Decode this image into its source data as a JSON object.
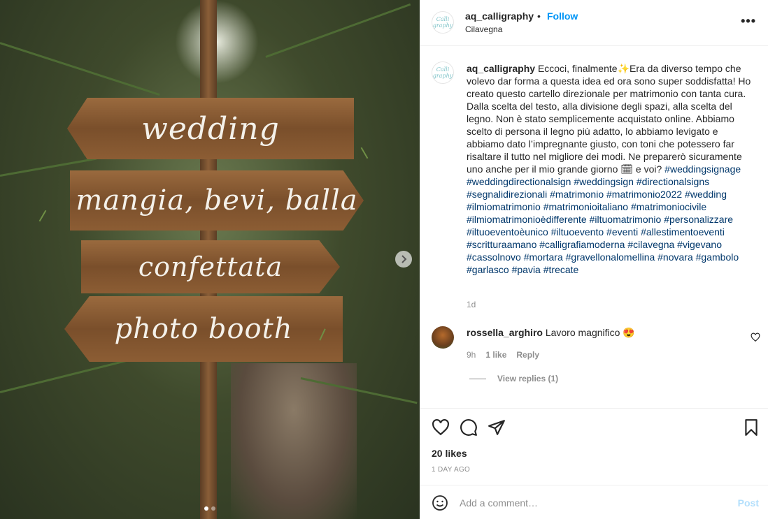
{
  "photo": {
    "signs": [
      "wedding",
      "mangia, bevi, balla",
      "confettata",
      "photo booth"
    ],
    "carousel": {
      "count": 2,
      "active": 1
    }
  },
  "post": {
    "username": "aq_calligraphy",
    "separator": "•",
    "follow_label": "Follow",
    "location": "Cilavegna",
    "more_icon": "•••",
    "avatar_text": "Calli graphy",
    "caption_username": "aq_calligraphy",
    "caption_text": "Eccoci, finalmente✨Era da diverso tempo che volevo dar forma a questa idea ed ora sono super soddisfatta! Ho creato questo cartello direzionale per matrimonio con tanta cura. Dalla scelta del testo, alla divisione degli spazi, alla scelta del legno. Non è stato semplicemente acquistato online. Abbiamo scelto di persona il legno più adatto, lo abbiamo levigato e abbiamo dato l’impregnante giusto, con toni che potessero far risaltare il tutto nel migliore dei modi. Ne preparerò sicuramente uno anche per il mio grande giorno 🗓 e voi?",
    "hashtags": "#weddingsignage #weddingdirectionalsign #weddingsign #directionalsigns #segnalidirezionali #matrimonio #matrimonio2022 #wedding #ilmiomatrimonio #matrimonioitaliano #matrimoniocivile #ilmiomatrimonioèdifferente #iltuomatrimonio #personalizzare #iltuoeventoèunico #iltuoevento #eventi #allestimentoeventi #scritturaamano #calligrafiamoderna #cilavegna #vigevano #cassolnovo #mortara #gravellonalomellina #novara #gambolo #garlasco #pavia #trecate",
    "caption_time": "1d"
  },
  "comment": {
    "username": "rossella_arghiro",
    "text": "Lavoro magnifico 😍",
    "time": "9h",
    "likes": "1 like",
    "reply_label": "Reply",
    "view_replies": "View replies (1)"
  },
  "actions": {
    "likes": "20 likes",
    "date": "1 DAY AGO"
  },
  "add_comment": {
    "placeholder": "Add a comment…",
    "post_label": "Post"
  },
  "colors": {
    "link": "#0095f6",
    "hashtag": "#00376b",
    "muted": "#8e8e8e",
    "post_disabled": "#b2dffc"
  }
}
